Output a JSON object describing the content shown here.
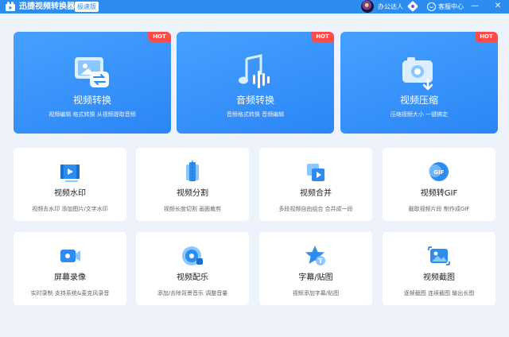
{
  "window": {
    "title": "迅捷视频转换器",
    "edition": "极速版",
    "user_name": "办公达人",
    "help_label": "客服中心",
    "minimize": "—",
    "close": "✕"
  },
  "hero_cards": [
    {
      "title": "视频转换",
      "desc": "视频编辑 格式转换 从视频提取音频",
      "badge": "HOT",
      "icon": "video-convert-icon"
    },
    {
      "title": "音频转换",
      "desc": "音频格式转换 音频编辑",
      "badge": "HOT",
      "icon": "audio-convert-icon"
    },
    {
      "title": "视频压缩",
      "desc": "压缩视频大小 一键搞定",
      "badge": "HOT",
      "icon": "video-compress-icon"
    }
  ],
  "tool_cards": [
    {
      "title": "视频水印",
      "desc": "视频去水印 添加图片/文字水印",
      "icon": "watermark-icon"
    },
    {
      "title": "视频分割",
      "desc": "视频长度切割 画面裁剪",
      "icon": "split-icon"
    },
    {
      "title": "视频合并",
      "desc": "多段视频自由组合 合并成一段",
      "icon": "merge-icon"
    },
    {
      "title": "视频转GIF",
      "desc": "截取视频片段 制作成GIF",
      "icon": "gif-icon"
    },
    {
      "title": "屏幕录像",
      "desc": "实时录制 支持系统&麦克风录音",
      "icon": "screen-record-icon"
    },
    {
      "title": "视频配乐",
      "desc": "添加/去除背景音乐 调整音量",
      "icon": "music-icon"
    },
    {
      "title": "字幕/贴图",
      "desc": "视频添加字幕/贴图",
      "icon": "subtitle-sticker-icon"
    },
    {
      "title": "视频截图",
      "desc": "逐帧截图 连续截图 输出长图",
      "icon": "screenshot-icon"
    }
  ],
  "colors": {
    "accent": "#2d8cf0",
    "hot_badge": "#ff4b47",
    "background": "#eef3fb"
  }
}
